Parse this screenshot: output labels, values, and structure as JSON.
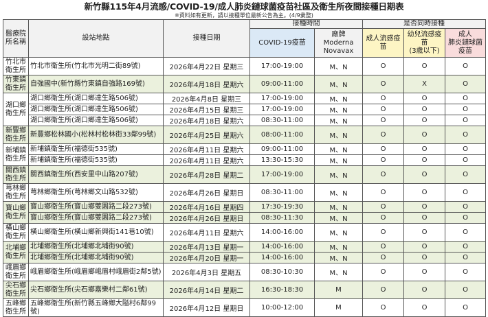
{
  "title": "新竹縣115年4月流感/COVID-19/成人肺炎鏈球菌疫苗社區及衛生所夜間接種日期表",
  "note": "※資料如有更新，請以接種單位最新公告為主。(4/9彙整)",
  "headers": {
    "hospital": "醫療院所名稱",
    "site": "設站地點",
    "date": "接種日期",
    "time_group": "接種時間",
    "covid": "COVID-19疫苗",
    "brand": "廠牌\nModerna\nNovavax",
    "concurrent": "是否同時接種",
    "flu_adult": "成人流感疫苗",
    "flu_child": "幼兒流感疫苗\n(3歲以下)",
    "pneumo": "成人\n肺炎鏈球菌疫苗"
  },
  "colors": {
    "green_row": "#ebf1dd",
    "covid_header": "#dbe9f6",
    "flu_header": "#fdf5c4",
    "pneumo_header": "#f9dcdc"
  },
  "groups": [
    {
      "hospital": "竹北市衛生所",
      "shade": "white",
      "rows": [
        {
          "site": "竹北市衛生所(竹北市光明二街89號)",
          "date": "2026年4月22日 星期三",
          "time": "17:00-19:00",
          "brand": "M、N",
          "flu": "O",
          "child": "O",
          "pn": "O"
        }
      ]
    },
    {
      "hospital": "竹東鎮衛生所",
      "shade": "green",
      "rows": [
        {
          "site": "自強國中(新竹縣竹東鎮自強路169號)",
          "date": "2026年4月18日 星期六",
          "time": "09:00-11:00",
          "brand": "M、N",
          "flu": "O",
          "child": "X",
          "pn": "O"
        }
      ]
    },
    {
      "hospital": "湖口鄉衛生所",
      "shade": "white",
      "rows": [
        {
          "site": "湖口鄉衛生所(湖口鄉達生路506號)",
          "date": "2026年4月8日 星期三",
          "time": "17:00-19:00",
          "brand": "M、N",
          "flu": "O",
          "child": "O",
          "pn": "O"
        },
        {
          "site": "湖口鄉衛生所(湖口鄉達生路506號)",
          "date": "2026年4月15日 星期三",
          "time": "17:00-19:00",
          "brand": "M、N",
          "flu": "O",
          "child": "O",
          "pn": "O"
        },
        {
          "site": "湖口鄉衛生所(湖口鄉達生路506號)",
          "date": "2026年4月18日 星期六",
          "time": "08:30-11:00",
          "brand": "M、N",
          "flu": "O",
          "child": "O",
          "pn": "O"
        }
      ]
    },
    {
      "hospital": "新豐鄉衛生所",
      "shade": "green",
      "rows": [
        {
          "site": "新豐鄉松林國小(松林村松林街33鄰99號)",
          "date": "2026年4月25日 星期六",
          "time": "08:00-11:00",
          "brand": "M、N",
          "flu": "O",
          "child": "O",
          "pn": "O"
        }
      ]
    },
    {
      "hospital": "新埔鎮衛生所",
      "shade": "white",
      "rows": [
        {
          "site": "新埔鎮衛生所(福德街535號)",
          "date": "2026年4月11日 星期六",
          "time": "09:00-11:00",
          "brand": "M、N",
          "flu": "O",
          "child": "O",
          "pn": "O"
        },
        {
          "site": "新埔鎮衛生所(福德街535號)",
          "date": "2026年4月11日 星期六",
          "time": "13:30-15:30",
          "brand": "M、N",
          "flu": "O",
          "child": "O",
          "pn": "O"
        }
      ]
    },
    {
      "hospital": "關西鎮衛生所",
      "shade": "green",
      "rows": [
        {
          "site": "關西鎮衛生所(西安里中山路207號)",
          "date": "2026年4月28日 星期二",
          "time": "17:00-19:00",
          "brand": "M、N",
          "flu": "O",
          "child": "O",
          "pn": "O"
        }
      ]
    },
    {
      "hospital": "芎林鄉衛生所",
      "shade": "white",
      "rows": [
        {
          "site": "芎林鄉衛生所(芎林鄉文山路532號)",
          "date": "2026年4月26日 星期日",
          "time": "08:30-11:00",
          "brand": "M、N",
          "flu": "O",
          "child": "O",
          "pn": "O"
        }
      ]
    },
    {
      "hospital": "寶山鄉衛生所",
      "shade": "green",
      "rows": [
        {
          "site": "寶山鄉衛生所(寶山鄉雙園路二段273號)",
          "date": "2026年4月16日 星期四",
          "time": "17:30-19:30",
          "brand": "M、N",
          "flu": "O",
          "child": "O",
          "pn": "O"
        },
        {
          "site": "寶山鄉衛生所(寶山鄉雙園路二段273號)",
          "date": "2026年4月26日 星期日",
          "time": "08:30-11:30",
          "brand": "M、N",
          "flu": "O",
          "child": "O",
          "pn": "O"
        }
      ]
    },
    {
      "hospital": "橫山鄉衛生所",
      "shade": "white",
      "rows": [
        {
          "site": "橫山鄉衛生所(橫山鄉新興街141巷10號)",
          "date": "2026年4月11日 星期六",
          "time": "14:00-16:00",
          "brand": "M、N",
          "flu": "O",
          "child": "O",
          "pn": "O"
        }
      ]
    },
    {
      "hospital": "北埔鄉衛生所",
      "shade": "green",
      "rows": [
        {
          "site": "北埔鄉衛生所(北埔鄉北埔街90號)",
          "date": "2026年4月13日 星期一",
          "time": "14:00-16:00",
          "brand": "M、N",
          "flu": "O",
          "child": "O",
          "pn": "O"
        },
        {
          "site": "北埔鄉衛生所(北埔鄉北埔街90號)",
          "date": "2026年4月20日 星期一",
          "time": "14:00-16:00",
          "brand": "M、N",
          "flu": "O",
          "child": "O",
          "pn": "O"
        }
      ]
    },
    {
      "hospital": "峨眉鄉衛生所",
      "shade": "white",
      "rows": [
        {
          "site": "峨眉鄉衛生所(峨眉鄉峨眉村峨眉街2鄰5號)",
          "date": "2026年4月3日 星期五",
          "time": "08:30-10:30",
          "brand": "M、N",
          "flu": "O",
          "child": "O",
          "pn": "O"
        }
      ]
    },
    {
      "hospital": "尖石鄉衛生所",
      "shade": "green",
      "rows": [
        {
          "site": "尖石鄉衛生所(尖石鄉嘉樂村二鄰61號)",
          "date": "2026年4月14日 星期二",
          "time": "16:30-18:30",
          "brand": "M",
          "flu": "O",
          "child": "O",
          "pn": "O"
        }
      ]
    },
    {
      "hospital": "五峰鄉衛生所",
      "shade": "white",
      "rows": [
        {
          "site": "五峰鄉衛生所(新竹縣五峰鄉大隘村6鄰99號)",
          "date": "2026年4月12日 星期日",
          "time": "10:00-12:00",
          "brand": "M",
          "flu": "O",
          "child": "O",
          "pn": "O"
        }
      ]
    }
  ]
}
